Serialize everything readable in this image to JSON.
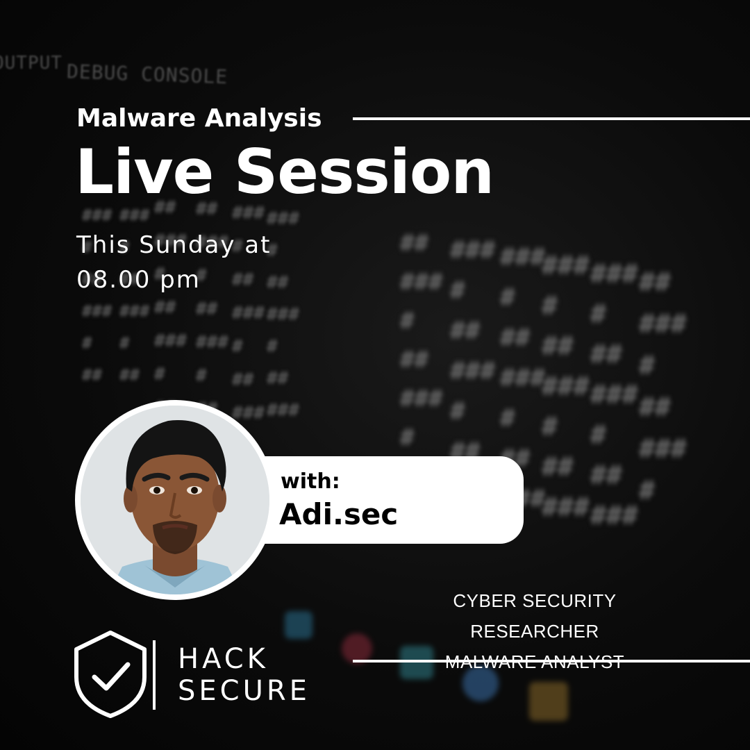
{
  "background": {
    "tab_output": "OUTPUT",
    "tab_debug": "DEBUG CONSOLE",
    "glyph_char": "#"
  },
  "event": {
    "subtitle": "Malware Analysis",
    "title": "Live Session",
    "day_line": "This Sunday at",
    "time_line": "08.00 pm"
  },
  "host": {
    "with_label": "with:",
    "name": "Adi.sec",
    "role_1": "CYBER SECURITY RESEARCHER",
    "role_2": "MALWARE ANALYST"
  },
  "brand": {
    "line_1": "HACK",
    "line_2": "SECURE",
    "logo": "shield-check-icon"
  },
  "colors": {
    "background": "#0b0b0b",
    "text": "#ffffff",
    "pill": "#ffffff"
  }
}
